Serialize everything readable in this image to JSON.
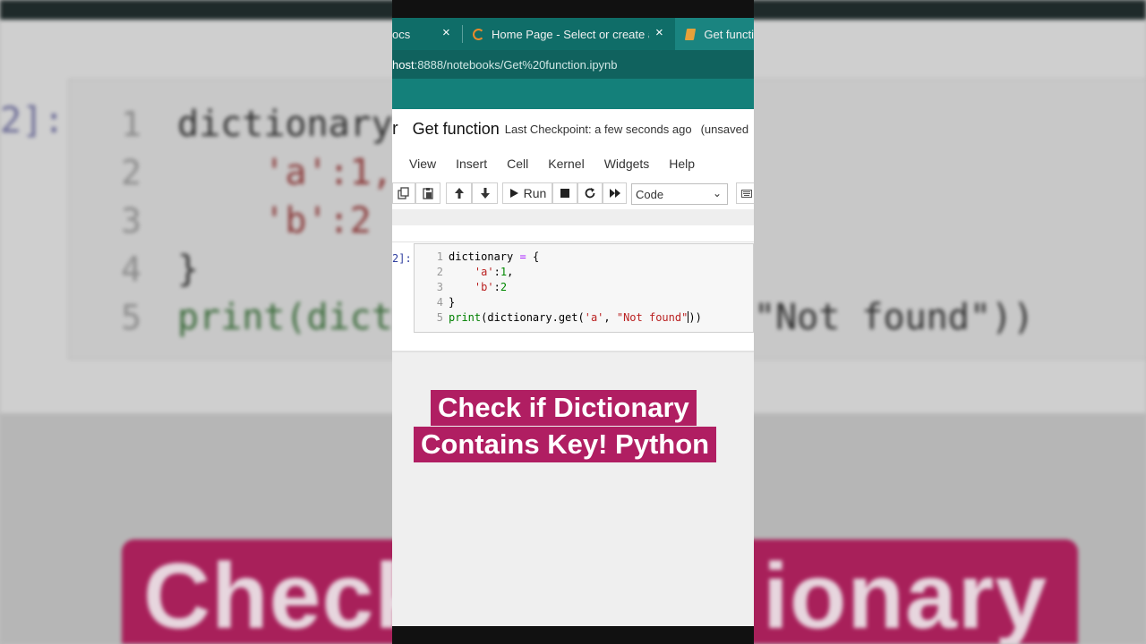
{
  "background": {
    "prompt": "2]:",
    "line_numbers": [
      "1",
      "2",
      "3",
      "4",
      "5"
    ],
    "code_lines": [
      "dictionary",
      "    'a':1,",
      "    'b':2",
      "}",
      "print(dict"
    ],
    "right_fragment": "\"Not found\"))",
    "banner_text_left": "Check",
    "banner_text_right": "ionary"
  },
  "browser": {
    "tabs": [
      {
        "label": "ocs",
        "close": "×"
      },
      {
        "label": "Home Page - Select or create a n",
        "close": "×"
      },
      {
        "label": "Get functi"
      }
    ],
    "url_host": "host",
    "url_path": ":8888/notebooks/Get%20function.ipynb"
  },
  "notebook": {
    "logo_fragment": "r",
    "title": "Get function",
    "checkpoint": "Last Checkpoint: a few seconds ago",
    "unsaved": "(unsaved",
    "menu": [
      "View",
      "Insert",
      "Cell",
      "Kernel",
      "Widgets",
      "Help"
    ],
    "toolbar": {
      "run_label": "Run",
      "cell_type": "Code"
    },
    "cell": {
      "prompt": "2]:",
      "line_numbers": [
        "1",
        "2",
        "3",
        "4",
        "5"
      ]
    }
  },
  "overlay": {
    "line1": "Check if Dictionary",
    "line2": "Contains Key! Python"
  },
  "colors": {
    "tab_bar": "#0f6d68",
    "banner": "#b01e62"
  }
}
